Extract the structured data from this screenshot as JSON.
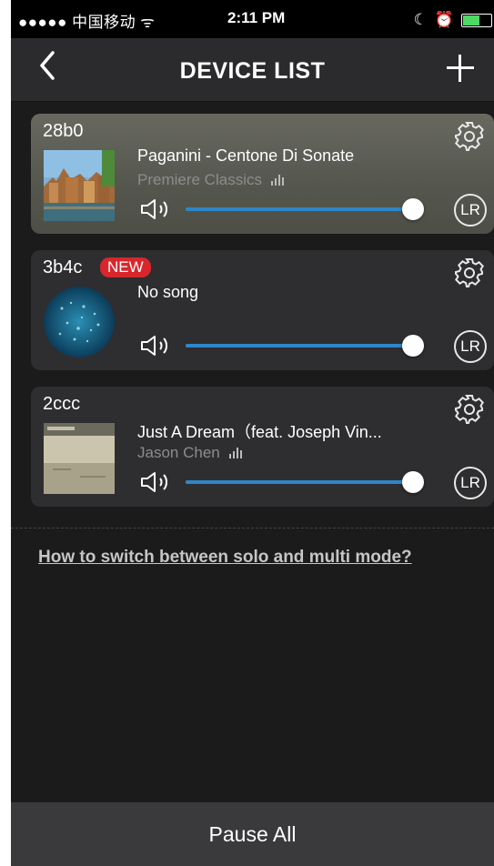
{
  "status_bar": {
    "carrier": "●●●●● 中国移动 ᯤ",
    "time": "2:11 PM"
  },
  "nav": {
    "title": "DEVICE LIST",
    "back_icon": "chevron-left-icon",
    "add_icon": "plus-icon"
  },
  "devices": [
    {
      "id": "28b0",
      "new": false,
      "song": "Paganini - Centone Di Sonate",
      "artist": "Premiere Classics",
      "volume": 1.0,
      "channel": "LR"
    },
    {
      "id": "3b4c",
      "new": true,
      "new_label": "NEW",
      "song": "No song",
      "artist": "",
      "volume": 1.0,
      "channel": "LR"
    },
    {
      "id": "2ccc",
      "new": false,
      "song": "Just A Dream（feat. Joseph Vin...",
      "artist": "Jason Chen",
      "volume": 1.0,
      "channel": "LR"
    }
  ],
  "help_link": "How to switch between solo and multi mode?",
  "bottom_button": "Pause All",
  "colors": {
    "accent_blue": "#2e86c8",
    "badge_red": "#d8262c",
    "background": "#1b1b1c"
  }
}
